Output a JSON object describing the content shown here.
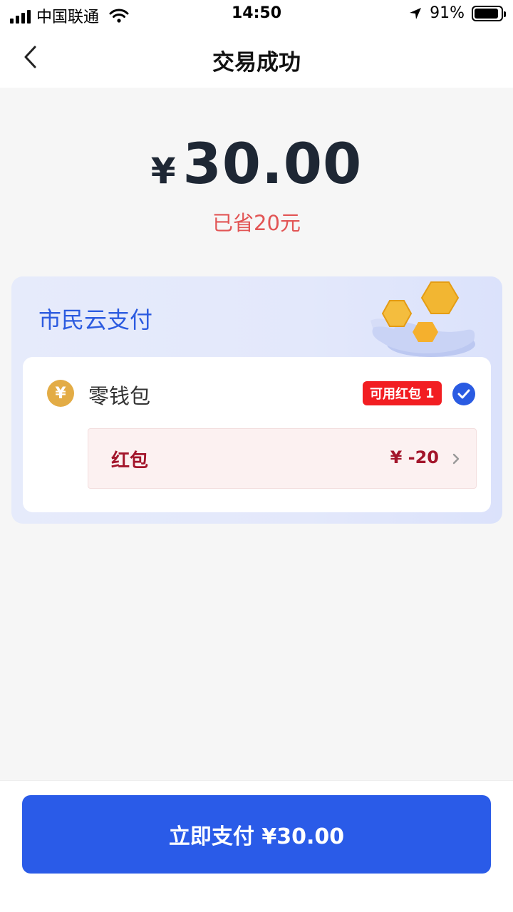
{
  "status_bar": {
    "carrier": "中国联通",
    "time": "14:50",
    "battery": "91%",
    "battery_level": 0.91
  },
  "nav": {
    "title": "交易成功",
    "back_icon": "chevron-left-icon"
  },
  "amount": {
    "currency": "¥",
    "value": "30.00",
    "saved_text": "已省20元"
  },
  "payment_method": {
    "title": "市民云支付",
    "wallet_label": "零钱包",
    "wallet_icon": "yuan-coin-icon",
    "wallet_icon_char": "¥",
    "badge_text": "可用红包",
    "badge_count": "1",
    "selected": true,
    "coupon": {
      "label": "红包",
      "amount": "¥ -20"
    }
  },
  "footer": {
    "pay_button_label": "立即支付 ¥30.00"
  },
  "colors": {
    "accent": "#2a5be8",
    "saved": "#e25555",
    "badge": "#f21e22",
    "coupon_text": "#a3152b",
    "coin": "#e3ac45"
  }
}
